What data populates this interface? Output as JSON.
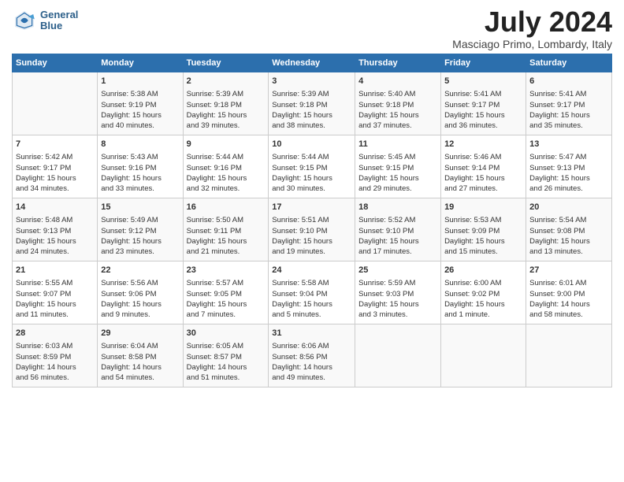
{
  "header": {
    "logo_line1": "General",
    "logo_line2": "Blue",
    "month_year": "July 2024",
    "location": "Masciago Primo, Lombardy, Italy"
  },
  "columns": [
    "Sunday",
    "Monday",
    "Tuesday",
    "Wednesday",
    "Thursday",
    "Friday",
    "Saturday"
  ],
  "weeks": [
    [
      {
        "day": "",
        "text": ""
      },
      {
        "day": "1",
        "text": "Sunrise: 5:38 AM\nSunset: 9:19 PM\nDaylight: 15 hours\nand 40 minutes."
      },
      {
        "day": "2",
        "text": "Sunrise: 5:39 AM\nSunset: 9:18 PM\nDaylight: 15 hours\nand 39 minutes."
      },
      {
        "day": "3",
        "text": "Sunrise: 5:39 AM\nSunset: 9:18 PM\nDaylight: 15 hours\nand 38 minutes."
      },
      {
        "day": "4",
        "text": "Sunrise: 5:40 AM\nSunset: 9:18 PM\nDaylight: 15 hours\nand 37 minutes."
      },
      {
        "day": "5",
        "text": "Sunrise: 5:41 AM\nSunset: 9:17 PM\nDaylight: 15 hours\nand 36 minutes."
      },
      {
        "day": "6",
        "text": "Sunrise: 5:41 AM\nSunset: 9:17 PM\nDaylight: 15 hours\nand 35 minutes."
      }
    ],
    [
      {
        "day": "7",
        "text": "Sunrise: 5:42 AM\nSunset: 9:17 PM\nDaylight: 15 hours\nand 34 minutes."
      },
      {
        "day": "8",
        "text": "Sunrise: 5:43 AM\nSunset: 9:16 PM\nDaylight: 15 hours\nand 33 minutes."
      },
      {
        "day": "9",
        "text": "Sunrise: 5:44 AM\nSunset: 9:16 PM\nDaylight: 15 hours\nand 32 minutes."
      },
      {
        "day": "10",
        "text": "Sunrise: 5:44 AM\nSunset: 9:15 PM\nDaylight: 15 hours\nand 30 minutes."
      },
      {
        "day": "11",
        "text": "Sunrise: 5:45 AM\nSunset: 9:15 PM\nDaylight: 15 hours\nand 29 minutes."
      },
      {
        "day": "12",
        "text": "Sunrise: 5:46 AM\nSunset: 9:14 PM\nDaylight: 15 hours\nand 27 minutes."
      },
      {
        "day": "13",
        "text": "Sunrise: 5:47 AM\nSunset: 9:13 PM\nDaylight: 15 hours\nand 26 minutes."
      }
    ],
    [
      {
        "day": "14",
        "text": "Sunrise: 5:48 AM\nSunset: 9:13 PM\nDaylight: 15 hours\nand 24 minutes."
      },
      {
        "day": "15",
        "text": "Sunrise: 5:49 AM\nSunset: 9:12 PM\nDaylight: 15 hours\nand 23 minutes."
      },
      {
        "day": "16",
        "text": "Sunrise: 5:50 AM\nSunset: 9:11 PM\nDaylight: 15 hours\nand 21 minutes."
      },
      {
        "day": "17",
        "text": "Sunrise: 5:51 AM\nSunset: 9:10 PM\nDaylight: 15 hours\nand 19 minutes."
      },
      {
        "day": "18",
        "text": "Sunrise: 5:52 AM\nSunset: 9:10 PM\nDaylight: 15 hours\nand 17 minutes."
      },
      {
        "day": "19",
        "text": "Sunrise: 5:53 AM\nSunset: 9:09 PM\nDaylight: 15 hours\nand 15 minutes."
      },
      {
        "day": "20",
        "text": "Sunrise: 5:54 AM\nSunset: 9:08 PM\nDaylight: 15 hours\nand 13 minutes."
      }
    ],
    [
      {
        "day": "21",
        "text": "Sunrise: 5:55 AM\nSunset: 9:07 PM\nDaylight: 15 hours\nand 11 minutes."
      },
      {
        "day": "22",
        "text": "Sunrise: 5:56 AM\nSunset: 9:06 PM\nDaylight: 15 hours\nand 9 minutes."
      },
      {
        "day": "23",
        "text": "Sunrise: 5:57 AM\nSunset: 9:05 PM\nDaylight: 15 hours\nand 7 minutes."
      },
      {
        "day": "24",
        "text": "Sunrise: 5:58 AM\nSunset: 9:04 PM\nDaylight: 15 hours\nand 5 minutes."
      },
      {
        "day": "25",
        "text": "Sunrise: 5:59 AM\nSunset: 9:03 PM\nDaylight: 15 hours\nand 3 minutes."
      },
      {
        "day": "26",
        "text": "Sunrise: 6:00 AM\nSunset: 9:02 PM\nDaylight: 15 hours\nand 1 minute."
      },
      {
        "day": "27",
        "text": "Sunrise: 6:01 AM\nSunset: 9:00 PM\nDaylight: 14 hours\nand 58 minutes."
      }
    ],
    [
      {
        "day": "28",
        "text": "Sunrise: 6:03 AM\nSunset: 8:59 PM\nDaylight: 14 hours\nand 56 minutes."
      },
      {
        "day": "29",
        "text": "Sunrise: 6:04 AM\nSunset: 8:58 PM\nDaylight: 14 hours\nand 54 minutes."
      },
      {
        "day": "30",
        "text": "Sunrise: 6:05 AM\nSunset: 8:57 PM\nDaylight: 14 hours\nand 51 minutes."
      },
      {
        "day": "31",
        "text": "Sunrise: 6:06 AM\nSunset: 8:56 PM\nDaylight: 14 hours\nand 49 minutes."
      },
      {
        "day": "",
        "text": ""
      },
      {
        "day": "",
        "text": ""
      },
      {
        "day": "",
        "text": ""
      }
    ]
  ]
}
